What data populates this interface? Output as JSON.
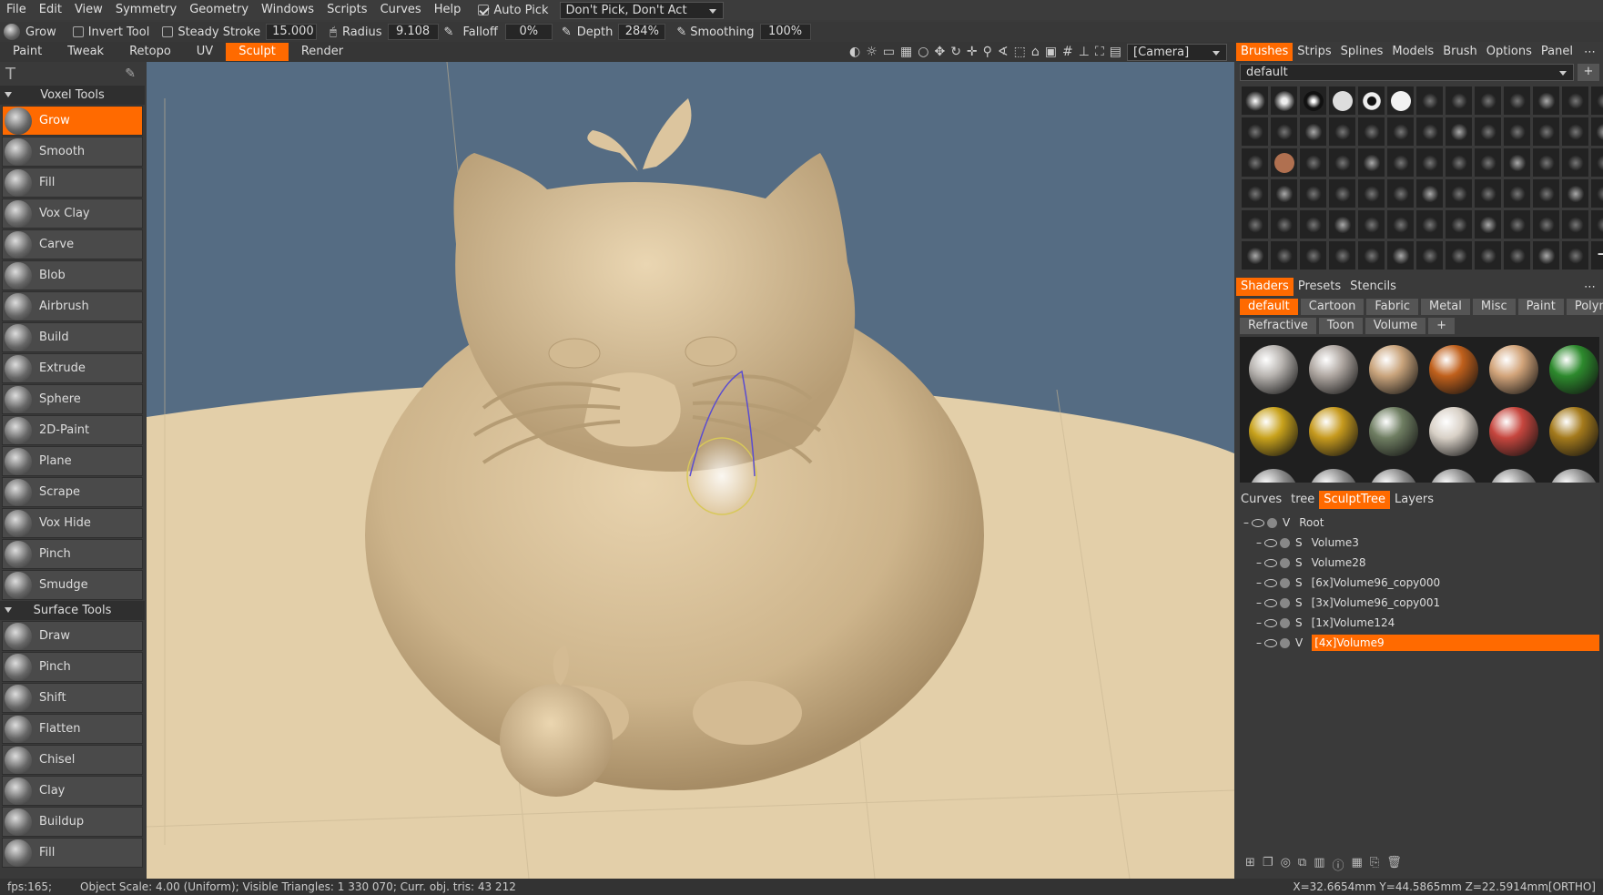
{
  "menubar": {
    "items": [
      "File",
      "Edit",
      "View",
      "Symmetry",
      "Geometry",
      "Windows",
      "Scripts",
      "Curves",
      "Help"
    ],
    "auto_pick": "Auto Pick",
    "pick_mode": "Don't Pick, Don't Act"
  },
  "toolbar": {
    "current_tool": "Grow",
    "invert_tool": "Invert Tool",
    "steady_stroke": "Steady Stroke",
    "steady_value": "15.000",
    "radius_label": "Radius",
    "radius_value": "9.108",
    "falloff_label": "Falloff",
    "falloff_value": "0%",
    "depth_label": "Depth",
    "depth_value": "284%",
    "smoothing_label": "Smoothing",
    "smoothing_value": "100%",
    "camera": "[Camera]"
  },
  "modes": [
    "Paint",
    "Tweak",
    "Retopo",
    "UV",
    "Sculpt",
    "Render"
  ],
  "active_mode": "Sculpt",
  "voxel_group": "Voxel  Tools",
  "voxel_tools": [
    "Grow",
    "Smooth",
    "Fill",
    "Vox Clay",
    "Carve",
    "Blob",
    "Airbrush",
    "Build",
    "Extrude",
    "Sphere",
    "2D-Paint",
    "Plane",
    "Scrape",
    "Vox Hide",
    "Pinch",
    "Smudge"
  ],
  "surface_group": "Surface  Tools",
  "surface_tools": [
    "Draw",
    "Pinch",
    "Shift",
    "Flatten",
    "Chisel",
    "Clay",
    "Buildup",
    "Fill"
  ],
  "brush_tabs": [
    "Brushes",
    "Strips",
    "Splines",
    "Models",
    "Brush",
    "Options",
    "Panel"
  ],
  "brush_preset": "default",
  "shader_tabs": [
    "Shaders",
    "Presets",
    "Stencils"
  ],
  "shader_cats1": [
    "default",
    "Cartoon",
    "Fabric",
    "Metal",
    "Misc",
    "Paint",
    "Polymer"
  ],
  "shader_cats2": [
    "Refractive",
    "Toon",
    "Volume"
  ],
  "shader_colors": [
    "#b8b4b0",
    "#b0a8a2",
    "#c9a47c",
    "#c0601c",
    "#d2a47a",
    "#2d8a2d",
    "#c8a21c",
    "#c69a1e",
    "#6f7e62",
    "#d8d0c6",
    "#c6463e",
    "#a47a1c"
  ],
  "tree_tabs": [
    "Curves",
    "tree",
    "SculptTree",
    "Layers"
  ],
  "tree": [
    {
      "type": "V",
      "name": "Root"
    },
    {
      "type": "S",
      "name": "Volume3"
    },
    {
      "type": "S",
      "name": "Volume28"
    },
    {
      "type": "S",
      "name": "[6x]Volume96_copy000"
    },
    {
      "type": "S",
      "name": "[3x]Volume96_copy001"
    },
    {
      "type": "S",
      "name": "[1x]Volume124"
    },
    {
      "type": "V",
      "name": "[4x]Volume9"
    }
  ],
  "status": {
    "fps": "fps:165;",
    "object_info": "Object Scale: 4.00 (Uniform); Visible Triangles: 1 330 070; Curr. obj. tris: 43 212",
    "coords": "X=32.6654mm Y=44.5865mm Z=22.5914mm[ORTHO]"
  }
}
